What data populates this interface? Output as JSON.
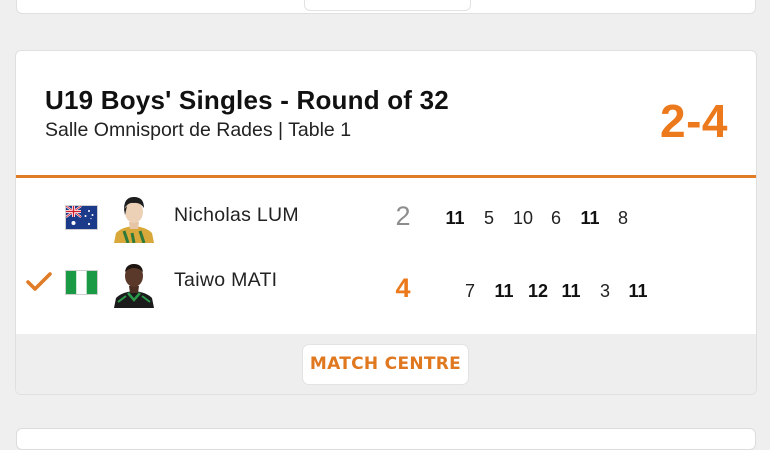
{
  "match": {
    "title": "U19 Boys' Singles - Round of 32",
    "venue": "Salle Omnisport de Rades | Table 1",
    "score": "2-4"
  },
  "players": [
    {
      "name": "Nicholas LUM",
      "country_flag": "australia-flag",
      "games_won": "2",
      "winner": false,
      "sets": [
        "11",
        "5",
        "10",
        "6",
        "11",
        "8"
      ],
      "sets_won": [
        true,
        false,
        false,
        false,
        true,
        false
      ]
    },
    {
      "name": "Taiwo MATI",
      "country_flag": "nigeria-flag",
      "games_won": "4",
      "winner": true,
      "sets": [
        "7",
        "11",
        "12",
        "11",
        "3",
        "11"
      ],
      "sets_won": [
        false,
        true,
        true,
        true,
        false,
        true
      ]
    }
  ],
  "footer": {
    "match_centre_label": "MATCH CENTRE"
  },
  "colors": {
    "accent": "#ec7a1c",
    "divider": "#e07b26",
    "loser_score": "#8d8d8d",
    "background": "#efefef"
  },
  "icons": {
    "winner_marker": "checkmark-icon"
  }
}
